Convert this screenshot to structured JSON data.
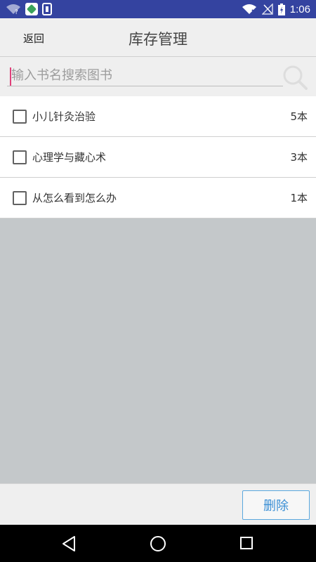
{
  "status_bar": {
    "time": "1:06",
    "icons": [
      "wifi-question-icon",
      "app-notification-icon",
      "download-notification-icon",
      "wifi-x-icon",
      "no-signal-icon",
      "battery-charging-icon"
    ]
  },
  "header": {
    "back_label": "返回",
    "title": "库存管理"
  },
  "search": {
    "placeholder": "输入书名搜索图书",
    "value": "",
    "icon": "search-icon"
  },
  "books": [
    {
      "name": "小儿针灸治验",
      "count": "5本",
      "checked": false
    },
    {
      "name": "心理学与藏心术",
      "count": "3本",
      "checked": false
    },
    {
      "name": "从怎么看到怎么办",
      "count": "1本",
      "checked": false
    }
  ],
  "footer": {
    "delete_label": "删除"
  },
  "colors": {
    "status_bar": "#3443a0",
    "accent_blue": "#3a8fd5",
    "caret_pink": "#e0407a",
    "empty_area": "#c4c8ca"
  },
  "nav_bar": {
    "icons": [
      "back-triangle-icon",
      "home-circle-icon",
      "recents-square-icon"
    ]
  }
}
